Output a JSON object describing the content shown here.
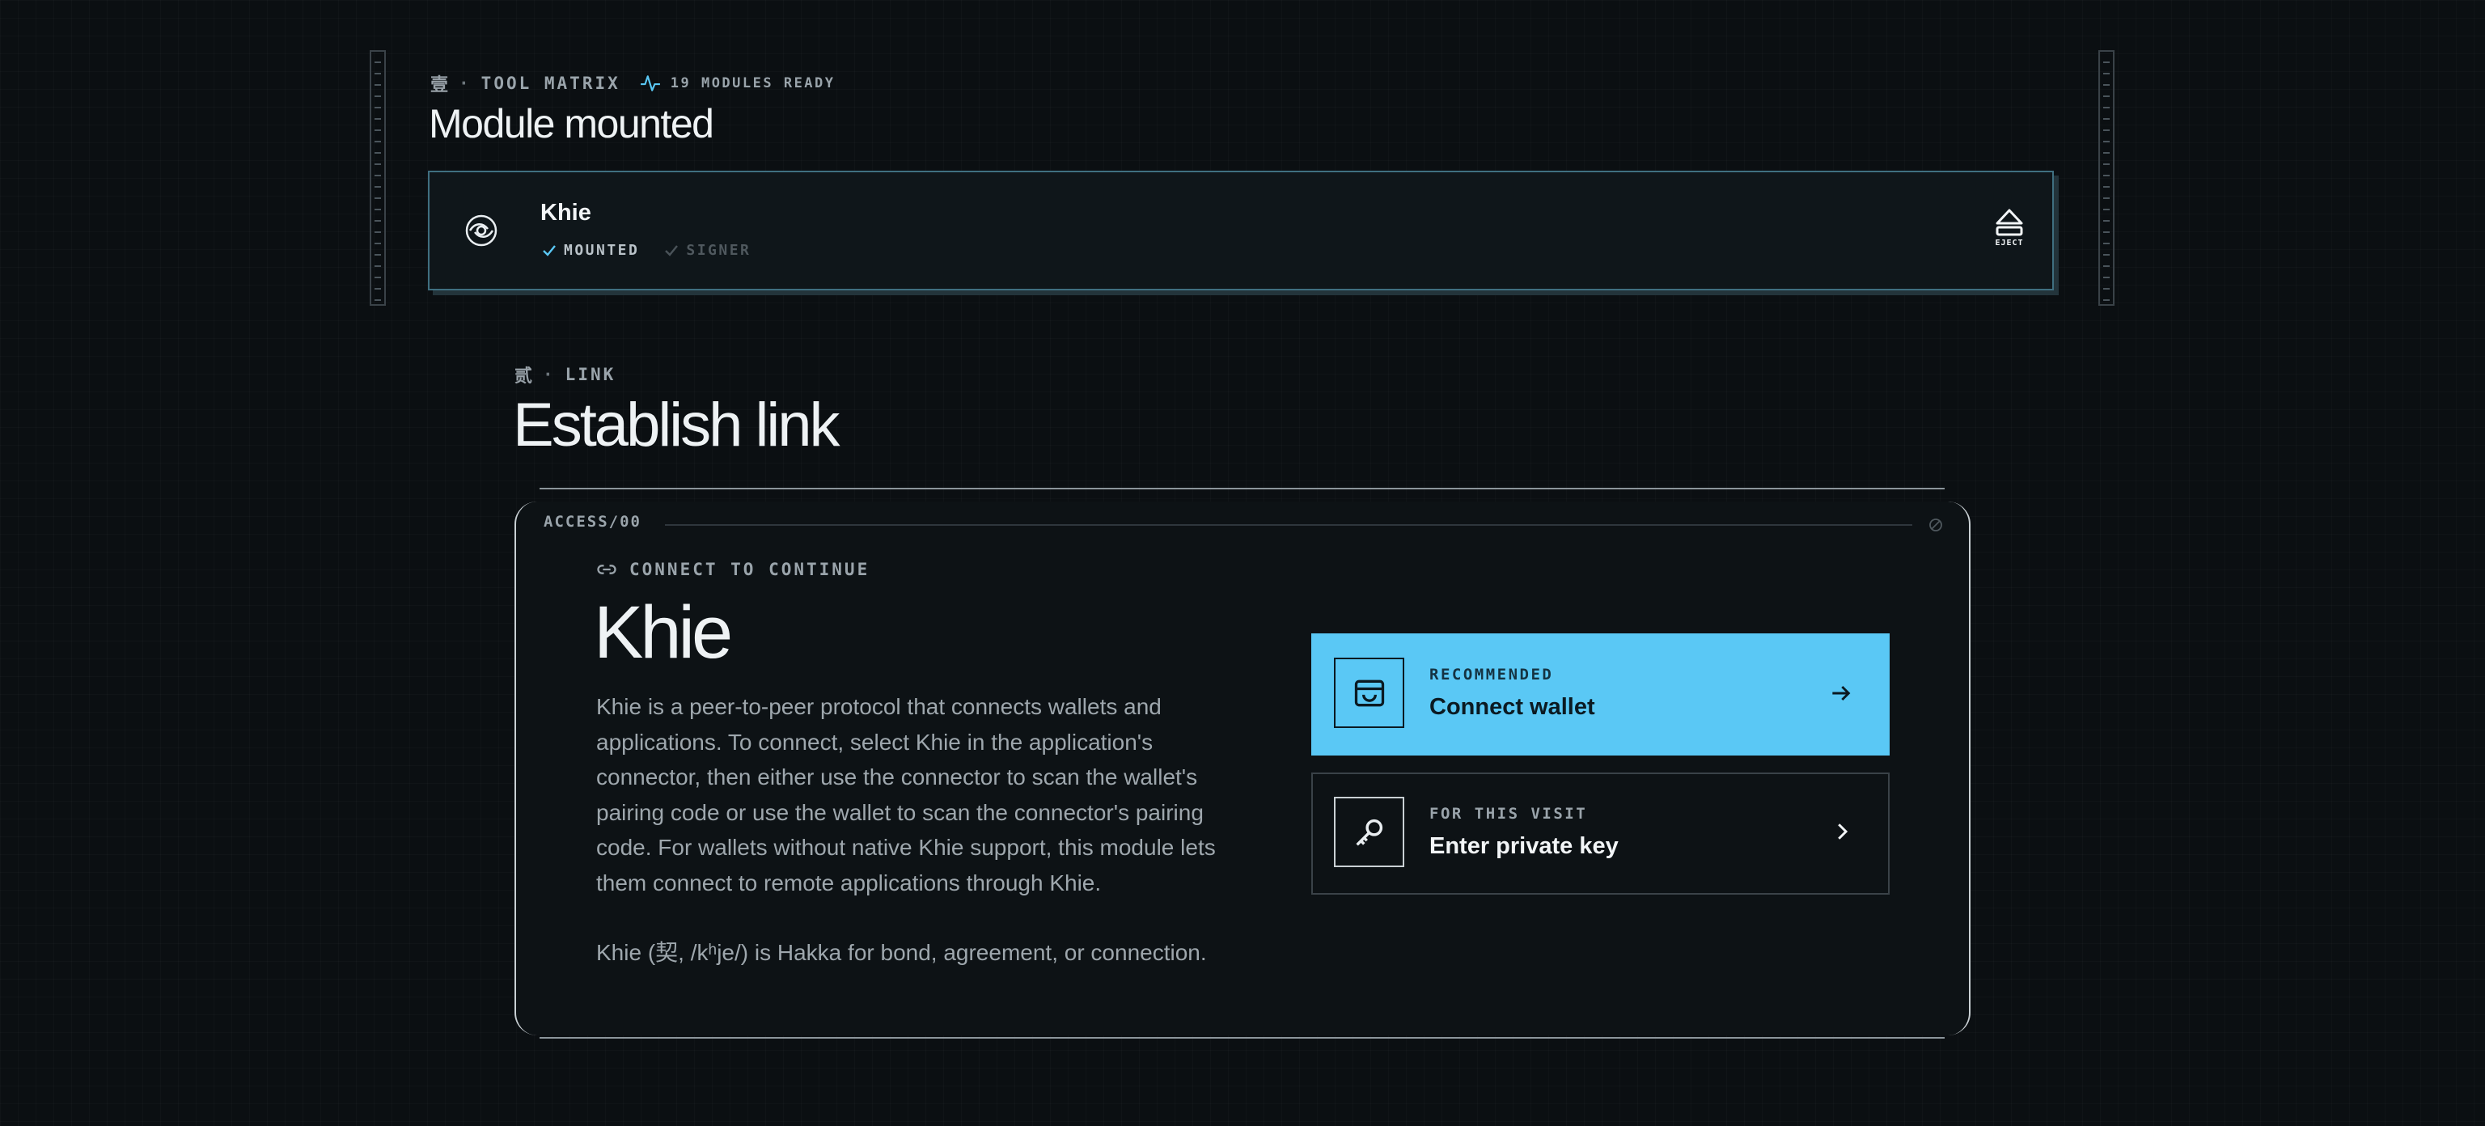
{
  "tool_matrix": {
    "glyph": "壹",
    "eyebrow": "TOOL MATRIX",
    "status": "19 MODULES READY",
    "title": "Module mounted"
  },
  "module": {
    "name": "Khie",
    "badge_mounted": "MOUNTED",
    "badge_signer": "SIGNER",
    "eject_label": "EJECT"
  },
  "link_section": {
    "glyph": "贰",
    "eyebrow": "LINK",
    "title": "Establish link"
  },
  "access": {
    "tag": "ACCESS/00",
    "connect_eyebrow": "CONNECT TO CONTINUE",
    "heading": "Khie",
    "description": "Khie is a peer-to-peer protocol that connects wallets and applications. To connect, select Khie in the application's connector, then either use the connector to scan the wallet's pairing code or use the wallet to scan the connector's pairing code. For wallets without native Khie support, this module lets them connect to remote applications through Khie.",
    "etymology": "Khie (契, /kʰje/) is Hakka for bond, agreement, or connection."
  },
  "options": {
    "primary": {
      "eyebrow": "RECOMMENDED",
      "label": "Connect wallet",
      "icon": "wallet-icon"
    },
    "secondary": {
      "eyebrow": "FOR THIS VISIT",
      "label": "Enter private key",
      "icon": "key-icon"
    }
  },
  "colors": {
    "accent": "#5ac8f5",
    "background": "#0b0f12",
    "card_border": "#3f6f80"
  }
}
